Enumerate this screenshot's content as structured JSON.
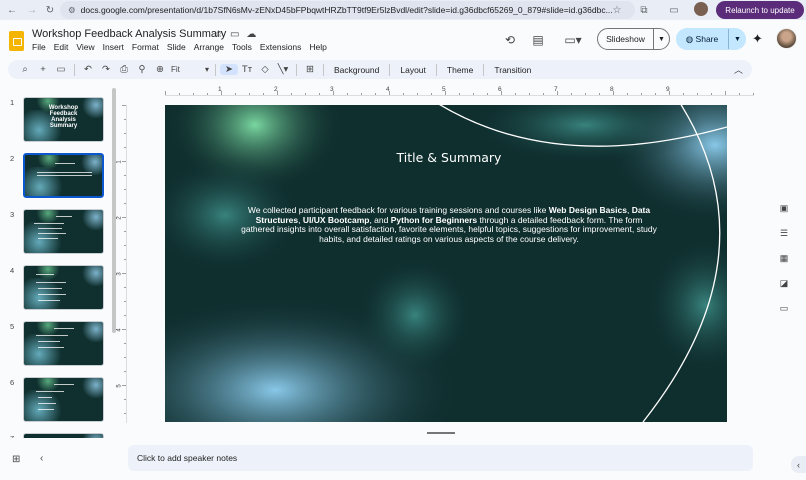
{
  "browser": {
    "url": "docs.google.com/presentation/d/1b7SfN6sMv-zENxD45bFPbqwtHRZbTT9tf9Er5lzBvdl/edit?slide=id.g36dbcf65269_0_879#slide=id.g36dbc...",
    "relaunch_label": "Relaunch to update"
  },
  "header": {
    "title": "Workshop Feedback Analysis Summary",
    "menu": [
      "File",
      "Edit",
      "View",
      "Insert",
      "Format",
      "Slide",
      "Arrange",
      "Tools",
      "Extensions",
      "Help"
    ],
    "slideshow_label": "Slideshow",
    "share_label": "Share"
  },
  "toolbar": {
    "zoom_value": "Fit",
    "background_label": "Background",
    "layout_label": "Layout",
    "theme_label": "Theme",
    "transition_label": "Transition"
  },
  "filmstrip": {
    "slides": [
      {
        "number": "1",
        "title": "Workshop Feedback Analysis Summary"
      },
      {
        "number": "2"
      },
      {
        "number": "3"
      },
      {
        "number": "4"
      },
      {
        "number": "5"
      },
      {
        "number": "6"
      },
      {
        "number": "7"
      }
    ]
  },
  "ruler": {
    "top": [
      "1",
      "2",
      "3",
      "4",
      "5",
      "6",
      "7",
      "8",
      "9"
    ],
    "left": [
      "1",
      "2",
      "3",
      "4",
      "5"
    ]
  },
  "slide": {
    "title": "Title & Summary",
    "body_intro": "We collected participant feedback for various training sessions and courses like ",
    "course1": "Web Design Basics",
    "sep1": ", ",
    "course2": "Data Structures",
    "sep2": ", ",
    "course3": "UI/UX Bootcamp",
    "sep3": ", and ",
    "course4": "Python for Beginners",
    "body_rest": " through a detailed feedback form. The form gathered insights into overall satisfaction, favorite elements, helpful topics, suggestions for improvement, study habits, and detailed ratings on various aspects of the course delivery.",
    "colors": {
      "bg": "#0f2e2e",
      "blue_glow": "#8fd0f2",
      "green_glow": "#7fe0a6"
    }
  },
  "notes": {
    "placeholder": "Click to add speaker notes"
  }
}
